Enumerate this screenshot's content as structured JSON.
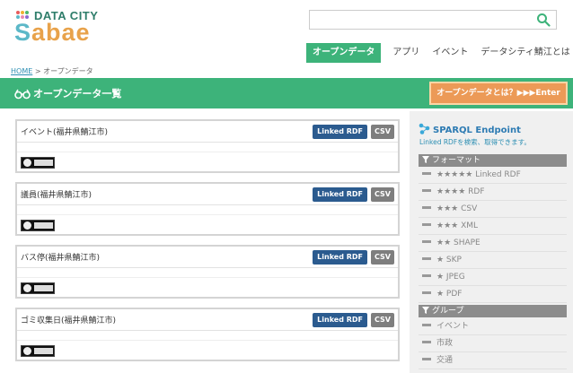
{
  "header": {
    "logo_top": "DATA CITY",
    "logo_main": "abae",
    "logo_s": "S",
    "search_placeholder": ""
  },
  "nav": {
    "items": [
      {
        "label": "オープンデータ",
        "active": true
      },
      {
        "label": "アプリ"
      },
      {
        "label": "イベント"
      },
      {
        "label": "データシティ鯖江とは"
      }
    ]
  },
  "breadcrumb": {
    "home": "HOME",
    "sep": ">",
    "current": "オープンデータ"
  },
  "bar": {
    "title": "オープンデータ一覧",
    "button": "オープンデータとは？▶▶▶Enter"
  },
  "datasets": [
    {
      "title": "イベント(福井県鯖江市)",
      "rdf": "Linked RDF",
      "csv": "CSV"
    },
    {
      "title": "議員(福井県鯖江市)",
      "rdf": "Linked RDF",
      "csv": "CSV"
    },
    {
      "title": "バス停(福井県鯖江市)",
      "rdf": "Linked RDF",
      "csv": "CSV"
    },
    {
      "title": "ゴミ収集日(福井県鯖江市)",
      "rdf": "Linked RDF",
      "csv": "CSV"
    }
  ],
  "sidebar": {
    "sparql_title": "SPARQL Endpoint",
    "sparql_sub": "Linked RDFを検索、取得できます。",
    "format_head": "フォーマット",
    "formats": [
      "★★★★★ Linked  RDF",
      "★★★★ RDF",
      "★★★ CSV",
      "★★★ XML",
      "★★ SHAPE",
      "★ SKP",
      "★ JPEG",
      "★ PDF"
    ],
    "group_head": "グループ",
    "groups": [
      "イベント",
      "市政",
      "交通"
    ]
  },
  "colors": {
    "green": "#3db37a",
    "orange": "#ec9a57",
    "rdf_blue": "#2b5b8f",
    "csv_gray": "#7e7e7e"
  }
}
